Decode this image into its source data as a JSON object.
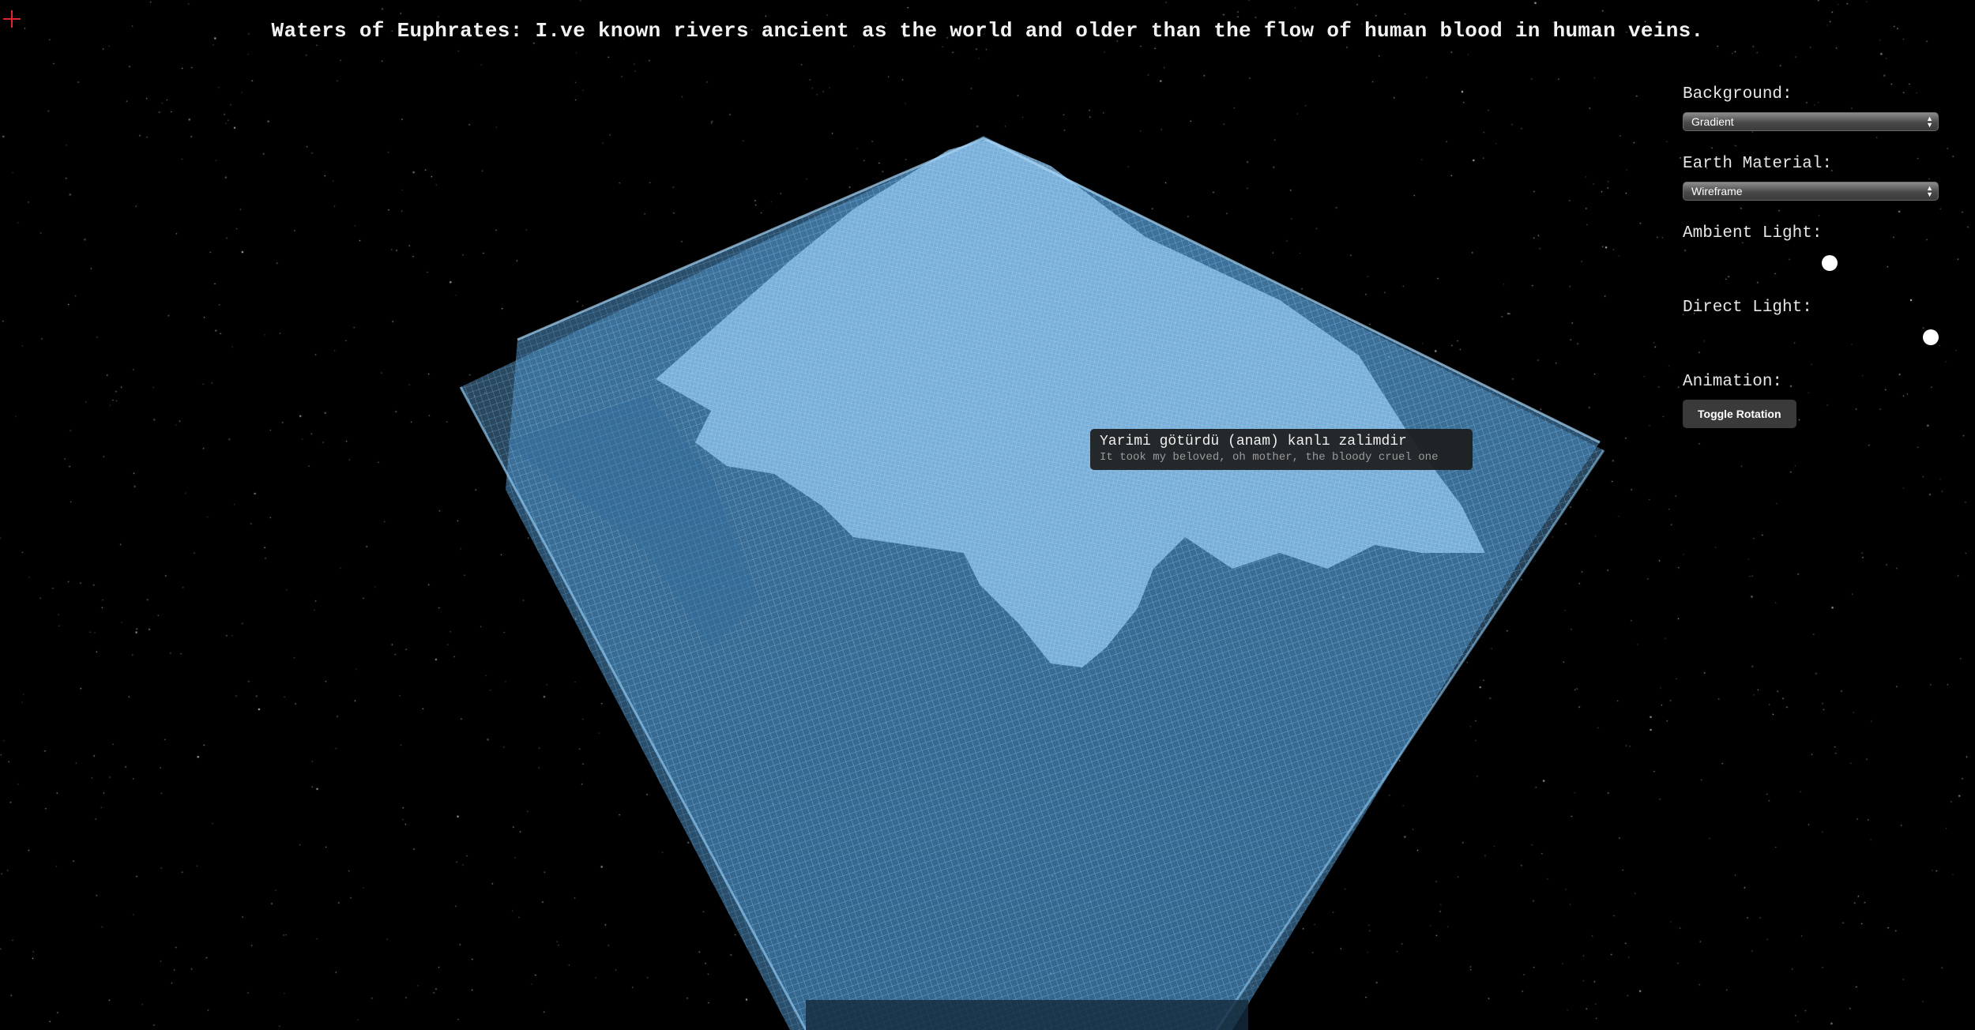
{
  "page": {
    "title": "Waters of Euphrates: I.ve known rivers ancient as the world and older than the flow of human blood in human veins."
  },
  "colors": {
    "background": "#000000",
    "terrain": "#5aa0d6",
    "crosshair": "#e0262b"
  },
  "controls": {
    "background": {
      "label": "Background:",
      "value": "Gradient"
    },
    "earth_material": {
      "label": "Earth Material:",
      "value": "Wireframe"
    },
    "ambient_light": {
      "label": "Ambient Light:",
      "level": 0.58
    },
    "direct_light": {
      "label": "Direct Light:",
      "level": 1.0
    },
    "animation": {
      "label": "Animation:",
      "button_label": "Toggle Rotation"
    }
  },
  "tooltip": {
    "original": "Yarimi götürdü (anam) kanlı zalimdir",
    "translation": "It took my beloved, oh mother, the bloody cruel one"
  },
  "icons": {
    "crosshair": "crosshair-icon",
    "select_arrow": "chevron-updown-icon"
  }
}
